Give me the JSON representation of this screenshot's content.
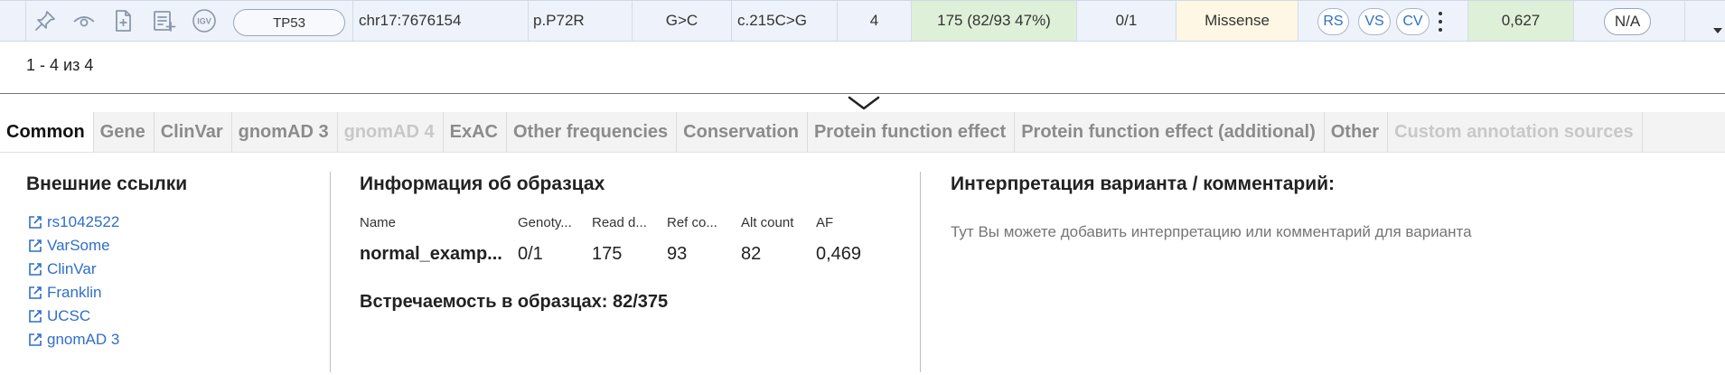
{
  "variant_row": {
    "gene": "TP53",
    "position": "chr17:7676154",
    "protein_change": "p.P72R",
    "nucleotide": "G>C",
    "cdna_change": "c.215C>G",
    "count": "4",
    "depth": "175  (82/93 47%)",
    "genotype": "0/1",
    "effect": "Missense",
    "tags": [
      "RS",
      "VS",
      "CV"
    ],
    "score": "0,627",
    "na_label": "N/A",
    "colors": {
      "depth_bg": "#dff0d8",
      "score_bg": "#dff0d8",
      "effect_bg": "#fdf7e3",
      "tag_text": "#2f6ec9"
    },
    "icons": [
      "pin-icon",
      "eye-icon",
      "add-file-icon",
      "note-list-icon",
      "igv-icon"
    ],
    "igv_label": "IGV"
  },
  "pagination": {
    "text": "1 - 4 из 4"
  },
  "tabs": [
    {
      "label": "Common",
      "state": "active"
    },
    {
      "label": "Gene",
      "state": "normal"
    },
    {
      "label": "ClinVar",
      "state": "normal"
    },
    {
      "label": "gnomAD 3",
      "state": "normal"
    },
    {
      "label": "gnomAD 4",
      "state": "disabled"
    },
    {
      "label": "ExAC",
      "state": "normal"
    },
    {
      "label": "Other frequencies",
      "state": "normal"
    },
    {
      "label": "Conservation",
      "state": "normal"
    },
    {
      "label": "Protein function effect",
      "state": "normal"
    },
    {
      "label": "Protein function effect (additional)",
      "state": "normal"
    },
    {
      "label": "Other",
      "state": "normal"
    },
    {
      "label": "Custom annotation sources",
      "state": "disabled"
    }
  ],
  "external_links": {
    "title": "Внешние ссылки",
    "items": [
      "rs1042522",
      "VarSome",
      "ClinVar",
      "Franklin",
      "UCSC",
      "gnomAD 3"
    ]
  },
  "samples": {
    "title": "Информация об образцах",
    "columns": [
      "Name",
      "Genoty...",
      "Read d...",
      "Ref co...",
      "Alt count",
      "AF"
    ],
    "rows": [
      [
        "normal_examp...",
        "0/1",
        "175",
        "93",
        "82",
        "0,469"
      ]
    ],
    "occurrence": "Встречаемость в образцах: 82/375"
  },
  "interpretation": {
    "title": "Интерпретация варианта / комментарий:",
    "placeholder": "Тут Вы можете добавить интерпретацию или комментарий для варианта"
  }
}
